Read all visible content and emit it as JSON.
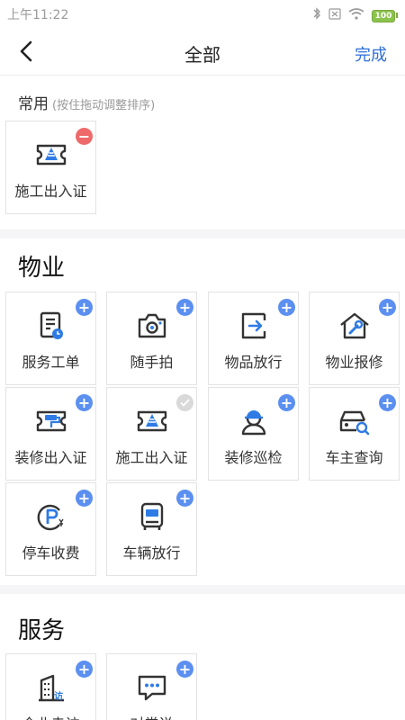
{
  "status_bar": {
    "time": "上午11:22",
    "battery": "100",
    "icons": [
      "bluetooth-icon",
      "sim-off-icon",
      "wifi-icon",
      "battery-icon"
    ]
  },
  "nav": {
    "back_icon": "chevron-left-icon",
    "title": "全部",
    "done": "完成"
  },
  "common": {
    "title": "常用",
    "hint": "(按住拖动调整排序)",
    "items": [
      {
        "label": "施工出入证",
        "icon": "construction-pass-icon",
        "badge": "remove"
      }
    ]
  },
  "sections": [
    {
      "title": "物业",
      "items": [
        {
          "label": "服务工单",
          "icon": "work-order-icon",
          "badge": "add"
        },
        {
          "label": "随手拍",
          "icon": "camera-icon",
          "badge": "add"
        },
        {
          "label": "物品放行",
          "icon": "item-release-icon",
          "badge": "add"
        },
        {
          "label": "物业报修",
          "icon": "house-repair-icon",
          "badge": "add"
        },
        {
          "label": "装修出入证",
          "icon": "decoration-pass-icon",
          "badge": "add"
        },
        {
          "label": "施工出入证",
          "icon": "construction-pass-icon",
          "badge": "added"
        },
        {
          "label": "装修巡检",
          "icon": "worker-inspection-icon",
          "badge": "add"
        },
        {
          "label": "车主查询",
          "icon": "car-search-icon",
          "badge": "add"
        },
        {
          "label": "停车收费",
          "icon": "parking-fee-icon",
          "badge": "add"
        },
        {
          "label": "车辆放行",
          "icon": "bus-release-icon",
          "badge": "add"
        }
      ]
    },
    {
      "title": "服务",
      "items": [
        {
          "label": "企业走访",
          "icon": "company-visit-icon",
          "badge": "add"
        },
        {
          "label": "对常说",
          "icon": "chat-bubble-icon",
          "badge": "add"
        }
      ]
    }
  ],
  "colors": {
    "accent": "#2e6fd8",
    "badge_add": "#5b8ff0",
    "badge_remove": "#ee6a6a",
    "icon_dark": "#333333",
    "icon_blue": "#2f7be5"
  }
}
